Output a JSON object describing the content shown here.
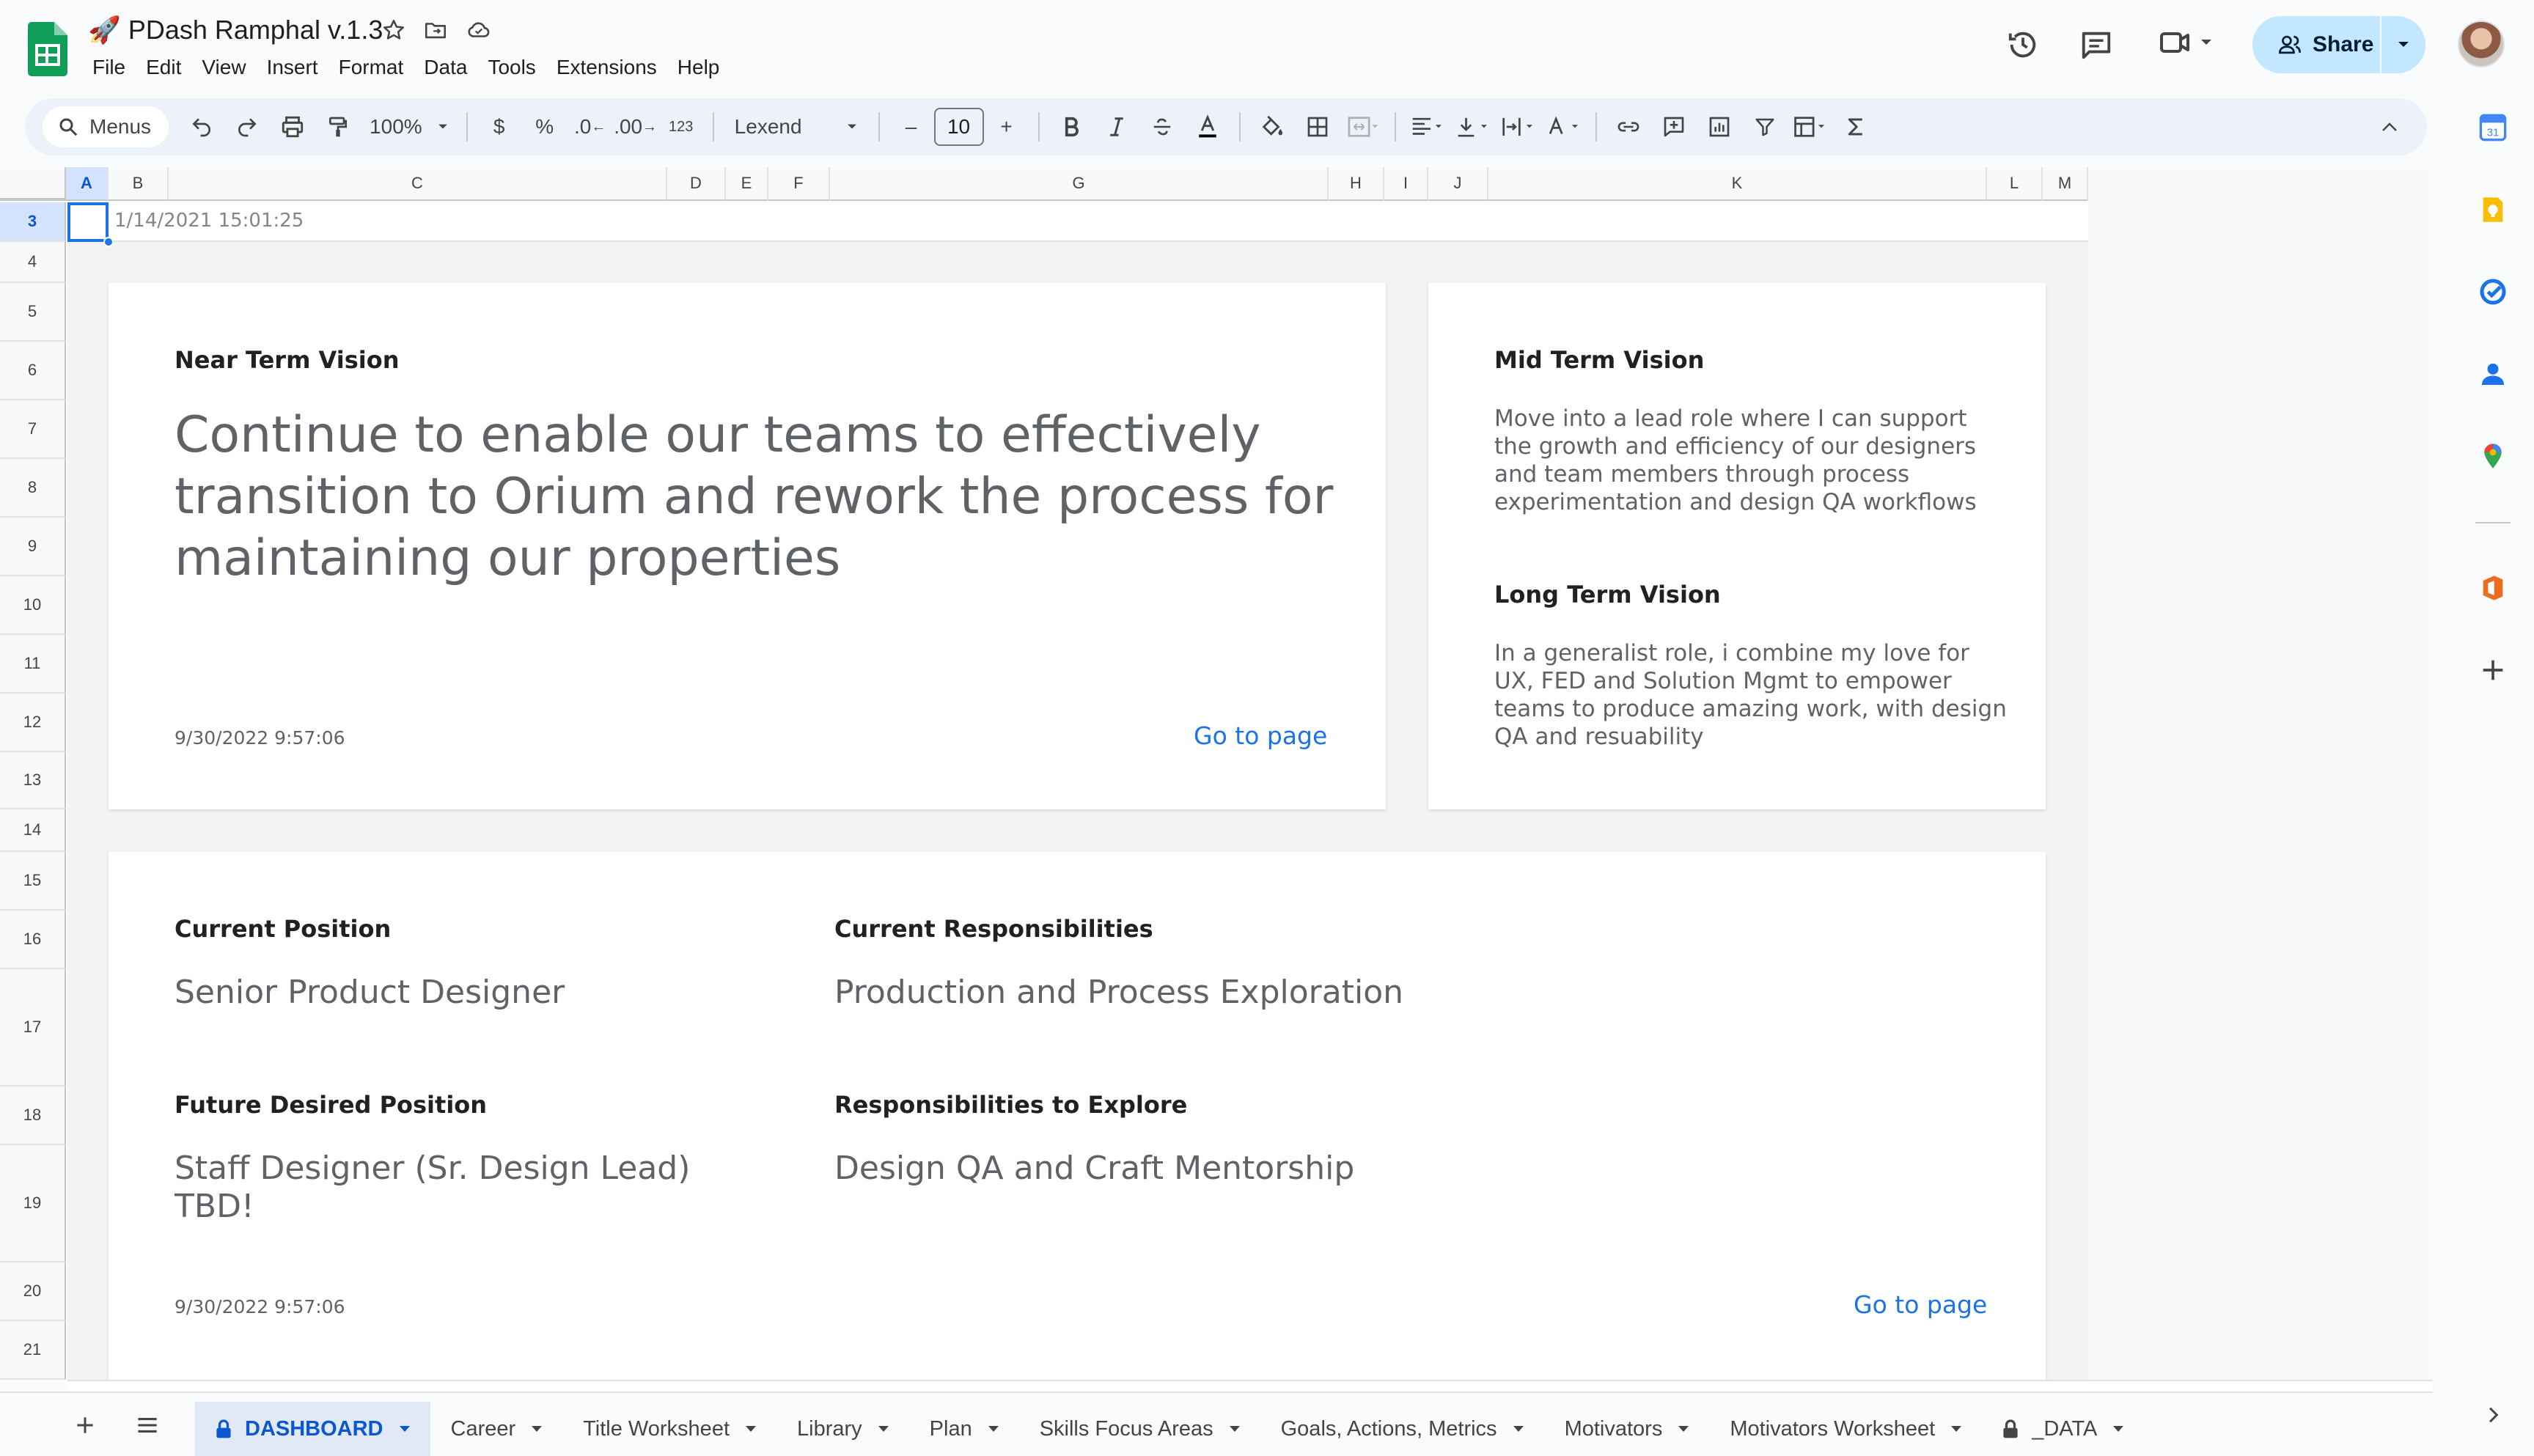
{
  "app": {
    "title": "PDash Ramphal v.1.3",
    "title_emoji": "🚀",
    "menu": [
      "File",
      "Edit",
      "View",
      "Insert",
      "Format",
      "Data",
      "Tools",
      "Extensions",
      "Help"
    ],
    "share_label": "Share",
    "accent": "#0b57d0",
    "share_bg": "#c2e7ff",
    "logo_color": "#0f9d58"
  },
  "toolbar": {
    "search_placeholder": "Menus",
    "zoom": "100%",
    "currency": "$",
    "percent": "%",
    "dec_decrease": ".0",
    "dec_increase": ".00",
    "number_format": "123",
    "font": "Lexend",
    "font_size": "10",
    "minus": "–",
    "plus": "+"
  },
  "grid": {
    "columns": [
      "A",
      "B",
      "C",
      "D",
      "E",
      "F",
      "G",
      "H",
      "I",
      "J",
      "K",
      "L",
      "M"
    ],
    "rows": [
      "3",
      "4",
      "5",
      "6",
      "7",
      "8",
      "9",
      "10",
      "11",
      "12",
      "13",
      "14",
      "15",
      "16",
      "17",
      "18",
      "19",
      "20",
      "21"
    ],
    "selected_column": "A",
    "selected_row": "3",
    "row3_value": "1/14/2021 15:01:25"
  },
  "cards": {
    "near_term": {
      "label": "Near Term Vision",
      "text": "Continue to enable our teams to effectively transition to Orium and rework the process for maintaining our properties",
      "date": "9/30/2022 9:57:06",
      "link": "Go to page"
    },
    "mid_term": {
      "label": "Mid Term Vision",
      "text": "Move into a lead role where I can support the growth and efficiency of our designers and team members through process experimentation and design QA workflows"
    },
    "long_term": {
      "label": "Long Term Vision",
      "text": "In a generalist role, i combine my love for UX, FED and Solution Mgmt to empower teams to produce amazing work, with design QA and resuability"
    },
    "position": {
      "current_position_label": "Current Position",
      "current_position": "Senior Product Designer",
      "current_resp_label": "Current Responsibilities",
      "current_resp": "Production and Process Exploration",
      "future_position_label": "Future Desired Position",
      "future_position_line1": "Staff Designer (Sr. Design Lead)",
      "future_position_line2": "TBD!",
      "explore_label": "Responsibilities to Explore",
      "explore": "Design QA and Craft Mentorship",
      "date": "9/30/2022 9:57:06",
      "link": "Go to page"
    }
  },
  "sheet_tabs": [
    {
      "label": "DASHBOARD",
      "locked": true,
      "active": true
    },
    {
      "label": "Career"
    },
    {
      "label": "Title Worksheet"
    },
    {
      "label": "Library"
    },
    {
      "label": "Plan"
    },
    {
      "label": "Skills Focus Areas"
    },
    {
      "label": "Goals, Actions, Metrics"
    },
    {
      "label": "Motivators"
    },
    {
      "label": "Motivators Worksheet"
    },
    {
      "label": "_DATA",
      "locked": true
    }
  ],
  "side_panel_icons": [
    "calendar-icon",
    "keep-icon",
    "tasks-icon",
    "contacts-icon",
    "maps-icon",
    "office-addon-icon",
    "add-icon"
  ]
}
